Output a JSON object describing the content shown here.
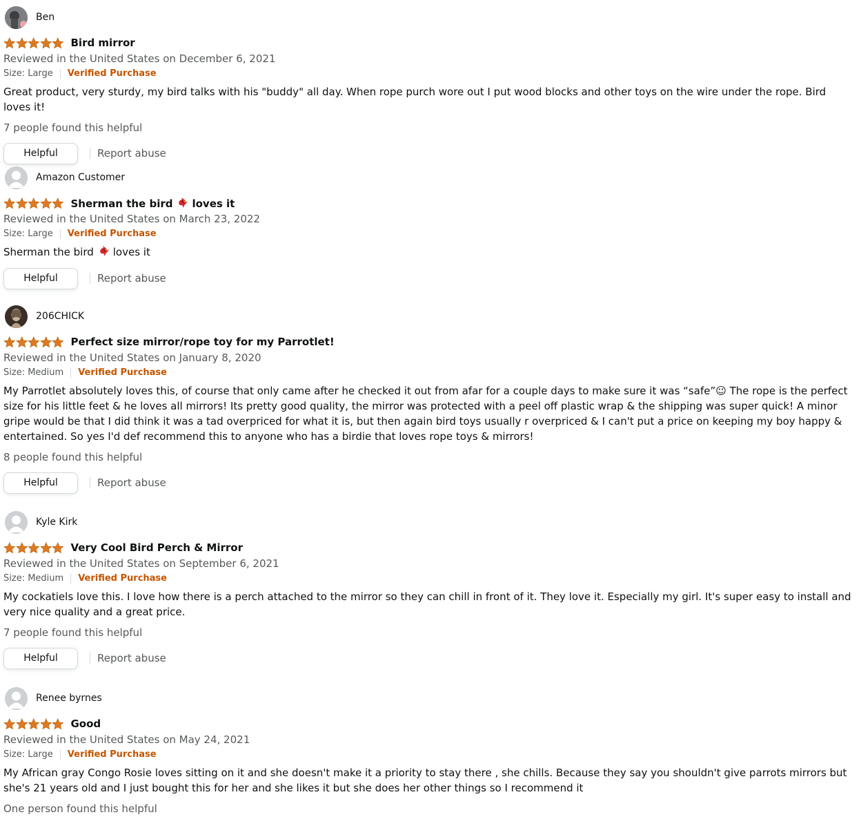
{
  "reviews": [
    {
      "reviewer": "Ben",
      "avatar": "photo-avatar",
      "rating": 5,
      "title": "Bird mirror",
      "date": "Reviewed in the United States on December 6, 2021",
      "size": "Size: Large",
      "verified": "Verified Purchase",
      "body": "Great product, very sturdy, my bird talks with his \"buddy\" all day. When rope purch wore out I put wood blocks and other toys on the wire under the rope. Bird loves it!",
      "helpful_count": "7 people found this helpful"
    },
    {
      "reviewer": "Amazon Customer",
      "avatar": "default-avatar",
      "rating": 5,
      "title_pre": "Sherman the bird",
      "title_post": "loves it",
      "date": "Reviewed in the United States on March 23, 2022",
      "size": "Size: Large",
      "verified": "Verified Purchase",
      "body_pre": "Sherman the bird",
      "body_post": "loves it"
    },
    {
      "reviewer": "206CHICK",
      "avatar": "photo-avatar",
      "rating": 5,
      "title": "Perfect size mirror/rope toy for my Parrotlet!",
      "date": "Reviewed in the United States on January 8, 2020",
      "size": "Size: Medium",
      "verified": "Verified Purchase",
      "body": "My Parrotlet absolutely loves this, of course that only came after he checked it out from afar for a couple days to make sure it was “safe”☺ The rope is the perfect size for his little feet & he loves all mirrors! Its pretty good quality, the mirror was protected with a peel off plastic wrap & the shipping was super quick! A minor gripe would be that I did think it was a tad overpriced for what it is, but then again bird toys usually r overpriced & I can't put a price on keeping my boy happy & entertained. So yes I'd def recommend this to anyone who has a birdie that loves rope toys & mirrors!",
      "helpful_count": "8 people found this helpful"
    },
    {
      "reviewer": "Kyle Kirk",
      "avatar": "default-avatar",
      "rating": 5,
      "title": "Very Cool Bird Perch & Mirror",
      "date": "Reviewed in the United States on September 6, 2021",
      "size": "Size: Medium",
      "verified": "Verified Purchase",
      "body": "My cockatiels love this. I love how there is a perch attached to the mirror so they can chill in front of it. They love it. Especially my girl. It's super easy to install and very nice quality and a great price.",
      "helpful_count": "7 people found this helpful"
    },
    {
      "reviewer": "Renee byrnes",
      "avatar": "default-avatar",
      "rating": 5,
      "title": "Good",
      "date": "Reviewed in the United States on May 24, 2021",
      "size": "Size: Large",
      "verified": "Verified Purchase",
      "body": "My African gray Congo Rosie loves sitting on it and she doesn't make it a priority to stay there , she chills. Because they say you shouldn't give parrots mirrors but she's 21 years old and I just bought this for her and she likes it but she does her other things so I recommend it",
      "helpful_count": "One person found this helpful"
    }
  ],
  "actions": {
    "helpful_label": "Helpful",
    "report_label": "Report abuse"
  },
  "colors": {
    "star": "#de7921",
    "verified": "#c45500",
    "secondary_text": "#565959"
  }
}
